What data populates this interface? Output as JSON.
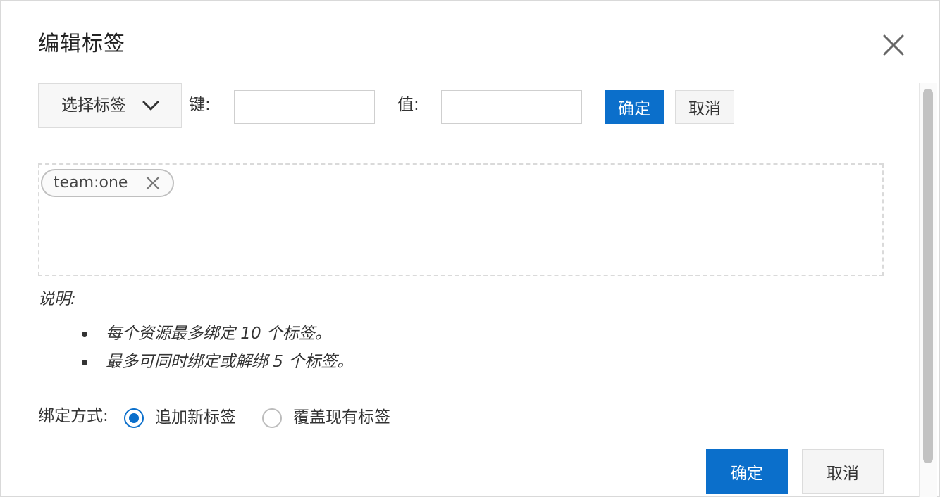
{
  "dialog": {
    "title": "编辑标签",
    "close_icon": "close-icon"
  },
  "toolbar": {
    "select_label": "选择标签",
    "select_icon": "chevron-down-icon",
    "key_label": "键:",
    "key_value": "",
    "value_label": "值:",
    "value_value": "",
    "confirm_label": "确定",
    "cancel_label": "取消"
  },
  "tags": [
    {
      "text": "team:one",
      "remove_icon": "close-icon"
    }
  ],
  "description": {
    "title": "说明:",
    "items": [
      "每个资源最多绑定 10 个标签。",
      "最多可同时绑定或解绑 5 个标签。"
    ]
  },
  "binding": {
    "label": "绑定方式:",
    "options": [
      {
        "label": "追加新标签",
        "checked": true
      },
      {
        "label": "覆盖现有标签",
        "checked": false
      }
    ]
  },
  "footer": {
    "confirm_label": "确定",
    "cancel_label": "取消"
  },
  "colors": {
    "primary": "#0b6fcb",
    "border": "#dcdcdc"
  }
}
